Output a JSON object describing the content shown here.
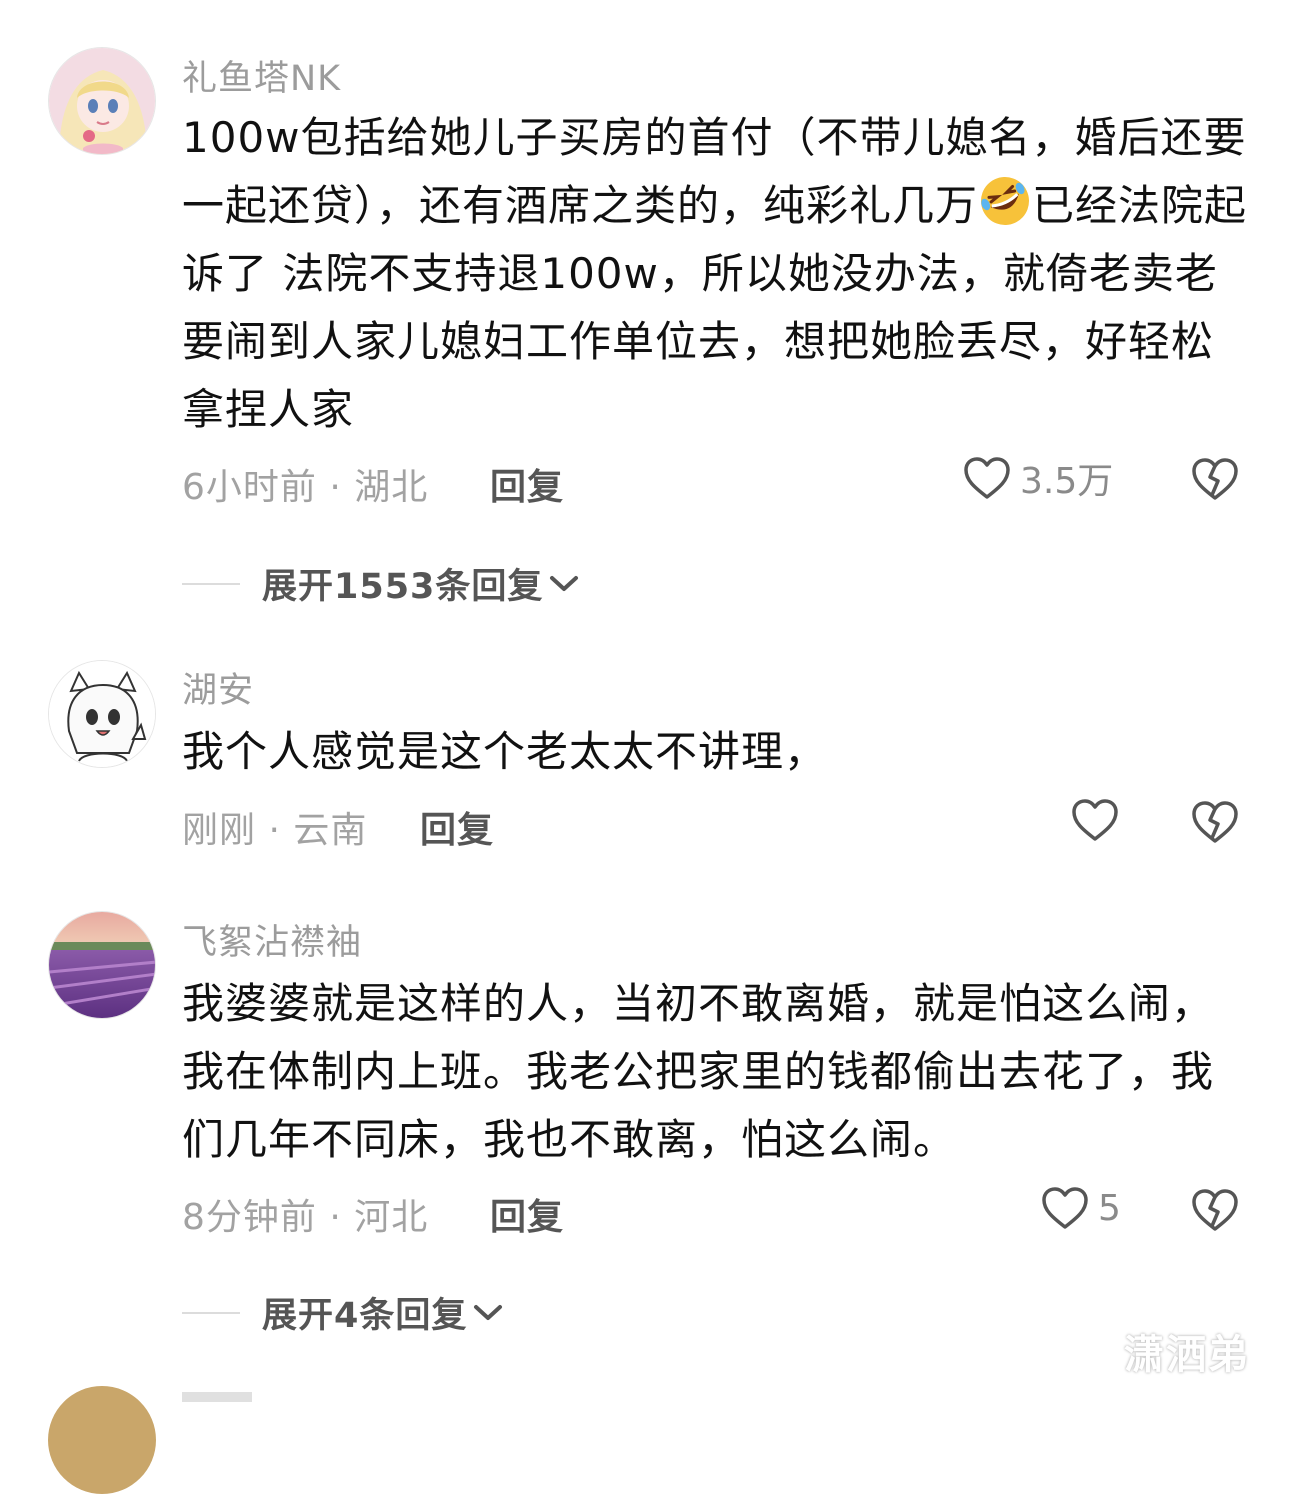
{
  "comments": [
    {
      "username": "礼鱼塔NK",
      "text_before_emoji": "100w包括给她儿子买房的首付（不带儿媳名，婚后还要一起还贷），还有酒席之类的，纯彩礼几万",
      "emoji": "rolling-on-floor-laughing-emoji",
      "text_after_emoji": "已经法院起诉了  法院不支持退100w，所以她没办法，就倚老卖老要闹到人家儿媳妇工作单位去，想把她脸丢尽，好轻松拿捏人家",
      "meta": "6小时前 · 湖北",
      "reply_label": "回复",
      "likes": "3.5万",
      "like_icon": "heart-outline-icon",
      "dislike_icon": "broken-heart-icon",
      "expand_label": "展开1553条回复"
    },
    {
      "username": "湖安",
      "text": "我个人感觉是这个老太太不讲理，",
      "meta": "刚刚 · 云南",
      "reply_label": "回复",
      "likes": "",
      "like_icon": "heart-outline-icon",
      "dislike_icon": "broken-heart-icon"
    },
    {
      "username": "飞絮沾襟袖",
      "text": "我婆婆就是这样的人，当初不敢离婚，就是怕这么闹，我在体制内上班。我老公把家里的钱都偷出去花了，我们几年不同床，我也不敢离，怕这么闹。",
      "meta": "8分钟前 · 河北",
      "reply_label": "回复",
      "likes": "5",
      "like_icon": "heart-outline-icon",
      "dislike_icon": "broken-heart-icon",
      "expand_label": "展开4条回复"
    }
  ],
  "watermark": "潇洒弟",
  "colors": {
    "background": "#ffffff",
    "text": "#111111",
    "secondary": "#9c9c9c",
    "reply": "#555555"
  }
}
